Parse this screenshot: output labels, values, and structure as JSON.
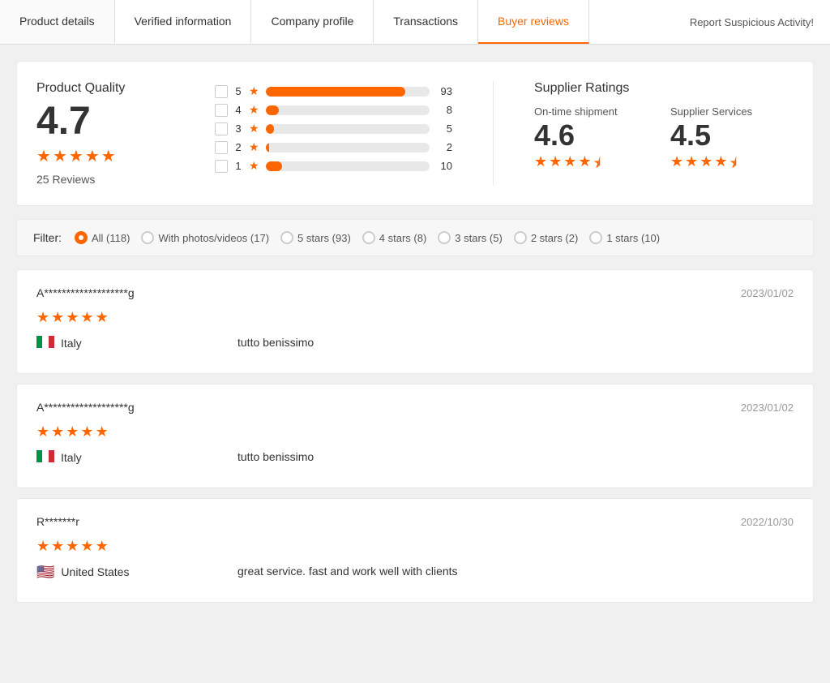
{
  "tabs": [
    {
      "id": "product-details",
      "label": "Product details",
      "active": false
    },
    {
      "id": "verified-information",
      "label": "Verified information",
      "active": false
    },
    {
      "id": "company-profile",
      "label": "Company profile",
      "active": false
    },
    {
      "id": "transactions",
      "label": "Transactions",
      "active": false
    },
    {
      "id": "buyer-reviews",
      "label": "Buyer reviews",
      "active": true
    }
  ],
  "report_button_label": "Report Suspicious Activity!",
  "product_quality": {
    "title": "Product Quality",
    "score": "4.7",
    "reviews_label": "25 Reviews"
  },
  "bar_chart": [
    {
      "stars": "5",
      "count": 93,
      "percent": 85
    },
    {
      "stars": "4",
      "count": 8,
      "percent": 8
    },
    {
      "stars": "3",
      "count": 5,
      "percent": 5
    },
    {
      "stars": "2",
      "count": 2,
      "percent": 2
    },
    {
      "stars": "1",
      "count": 10,
      "percent": 10
    }
  ],
  "supplier_ratings": {
    "title": "Supplier Ratings",
    "items": [
      {
        "label": "On-time shipment",
        "score": "4.6",
        "stars": 4.5
      },
      {
        "label": "Supplier Services",
        "score": "4.5",
        "stars": 4.5
      }
    ]
  },
  "filter": {
    "label": "Filter:",
    "options": [
      {
        "id": "all",
        "label": "All (118)",
        "selected": true
      },
      {
        "id": "photos",
        "label": "With photos/videos (17)",
        "selected": false
      },
      {
        "id": "5stars",
        "label": "5 stars (93)",
        "selected": false
      },
      {
        "id": "4stars",
        "label": "4 stars (8)",
        "selected": false
      },
      {
        "id": "3stars",
        "label": "3 stars (5)",
        "selected": false
      },
      {
        "id": "2stars",
        "label": "2 stars (2)",
        "selected": false
      },
      {
        "id": "1stars",
        "label": "1 stars (10)",
        "selected": false
      }
    ]
  },
  "reviews": [
    {
      "username": "A*******************g",
      "date": "2023/01/02",
      "stars": 5,
      "country": "Italy",
      "flag": "italy",
      "text": "tutto benissimo"
    },
    {
      "username": "A*******************g",
      "date": "2023/01/02",
      "stars": 5,
      "country": "Italy",
      "flag": "italy",
      "text": "tutto benissimo"
    },
    {
      "username": "R*******r",
      "date": "2022/10/30",
      "stars": 5,
      "country": "United States",
      "flag": "us",
      "text": "great service. fast and work well with clients"
    }
  ],
  "colors": {
    "accent": "#ff6600",
    "tab_active": "#ff6600"
  }
}
